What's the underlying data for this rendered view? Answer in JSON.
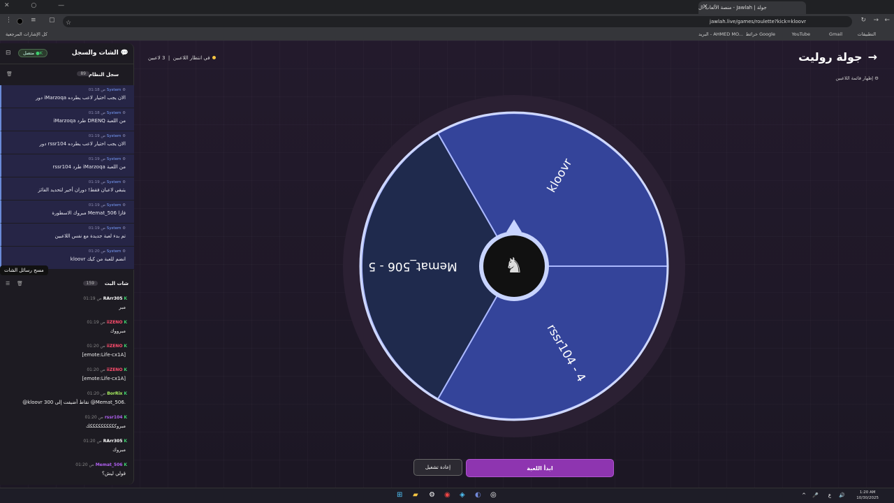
{
  "browser": {
    "tab_title": "جولة | Jawlah - منصة الألعاب ال",
    "url": "jawlah.live/games/roulette?kick=kloovr",
    "bookmarks": [
      "التطبيقات",
      "Gmail",
      "YouTube",
      "خرائط Google",
      "البريد - AHMED MO..."
    ],
    "all_bookmarks": "كل الإشارات المرجعية"
  },
  "sidebar": {
    "title": "الشات والسجل",
    "status": "متصل",
    "system_log": {
      "title": "سجل النظام",
      "count": "89",
      "messages": [
        {
          "sender": "System",
          "time": "01:18 ص",
          "text": "دور iMarzoqa الان يجب اختيار لاعب يطرده"
        },
        {
          "sender": "System",
          "time": "01:18 ص",
          "text": "iMarzoqa طرد DRENQ من اللعبة"
        },
        {
          "sender": "System",
          "time": "01:19 ص",
          "text": "دور rssr104 الان يجب اختيار لاعب يطرده"
        },
        {
          "sender": "System",
          "time": "01:19 ص",
          "text": "rssr104 طرد iMarzoqa من اللعبة"
        },
        {
          "sender": "System",
          "time": "01:19 ص",
          "text": "يتبقى لاعبان فقط! دوران أخير لتحديد الفائز"
        },
        {
          "sender": "System",
          "time": "01:19 ص",
          "text": "مبروك الاسطورة Memat_506 فازا"
        },
        {
          "sender": "System",
          "time": "01:19 ص",
          "text": "تم بدء لعبة جديدة مع نفس اللاعبين"
        },
        {
          "sender": "System",
          "time": "01:20 ص",
          "text": "kloovr انضم للعبة من كيك"
        }
      ]
    },
    "tooltip": "مسح رسائل الشات",
    "live_chat": {
      "title": "شات البث",
      "count": "159",
      "messages": [
        {
          "user": "RArr305",
          "color": "#ffffff",
          "time": "01:19 ص",
          "text": "مبر"
        },
        {
          "user": "iiZENO",
          "color": "#ff4d6d",
          "time": "01:19 ص",
          "text": "مبرووك"
        },
        {
          "user": "iiZENO",
          "color": "#ff4d6d",
          "time": "01:20 ص",
          "text": "[emote:Life-cx1A]"
        },
        {
          "user": "iiZENO",
          "color": "#ff4d6d",
          "time": "01:20 ص",
          "text": "[emote:Life-cx1A]"
        },
        {
          "user": "BorRix",
          "color": "#a8f060",
          "time": "01:20 ص",
          "text": "@kloovr 300 نقاط أضيفت إلى @Memat_506."
        },
        {
          "user": "rssr104",
          "color": "#b060f0",
          "time": "01:20 ص",
          "text": "مبروككككككككككك"
        },
        {
          "user": "RArr305",
          "color": "#ffffff",
          "time": "01:20 ص",
          "text": "مبروك"
        },
        {
          "user": "Memat_506",
          "color": "#b060f0",
          "time": "01:20 ص",
          "text": "قولي ليش؟"
        }
      ]
    }
  },
  "main": {
    "title": "جولة روليت",
    "show_players": "إظهار قائمة اللاعبين",
    "waiting": "في انتظار اللاعبين",
    "player_count": "3 لاعبين",
    "wheel": [
      {
        "label": "kloovr",
        "color": "#34449a"
      },
      {
        "label": "rssr104 - 4",
        "color": "#34449a"
      },
      {
        "label": "Memat_506 - 5",
        "color": "#1f2a4d"
      }
    ],
    "start_button": "ابدأ اللعبة",
    "replay_button": "إعادة تشغيل"
  },
  "taskbar": {
    "time": "1:20 AM",
    "date": "10/30/2025",
    "lang": "ع"
  }
}
